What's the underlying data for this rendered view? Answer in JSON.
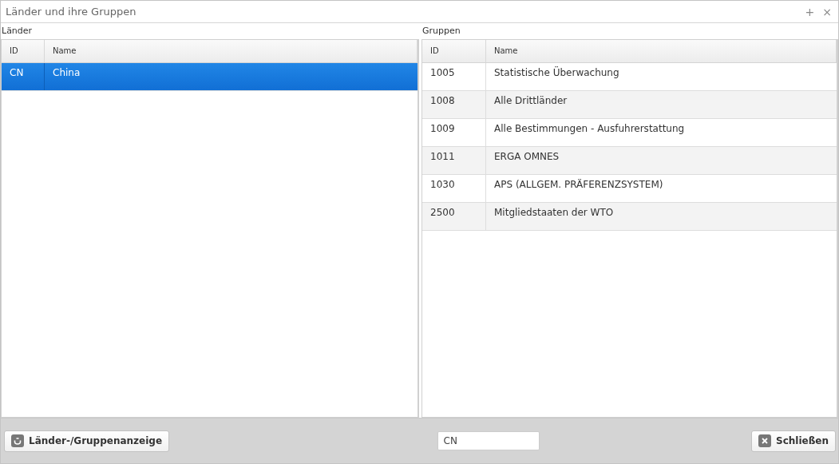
{
  "window": {
    "title": "Länder und ihre Gruppen",
    "controls": [
      "+",
      "×"
    ]
  },
  "countries": {
    "title": "Länder",
    "columns": [
      "ID",
      "Name"
    ],
    "rows": [
      {
        "id": "CN",
        "name": "China",
        "selected": true
      }
    ]
  },
  "groups": {
    "title": "Gruppen",
    "columns": [
      "ID",
      "Name"
    ],
    "rows": [
      {
        "id": "1005",
        "name": "Statistische Überwachung",
        "selected": false
      },
      {
        "id": "1008",
        "name": "Alle Drittländer",
        "selected": false
      },
      {
        "id": "1009",
        "name": "Alle Bestimmungen - Ausfuhrerstattung",
        "selected": false
      },
      {
        "id": "1011",
        "name": "ERGA OMNES",
        "selected": false
      },
      {
        "id": "1030",
        "name": "APS (ALLGEM. PRÄFERENZSYSTEM)",
        "selected": false
      },
      {
        "id": "2500",
        "name": "Mitgliedstaaten der WTO",
        "selected": false
      }
    ]
  },
  "footer": {
    "toggle_button": "Länder-/Gruppenanzeige",
    "filter": {
      "value": "CN"
    },
    "close_button": "Schließen"
  }
}
